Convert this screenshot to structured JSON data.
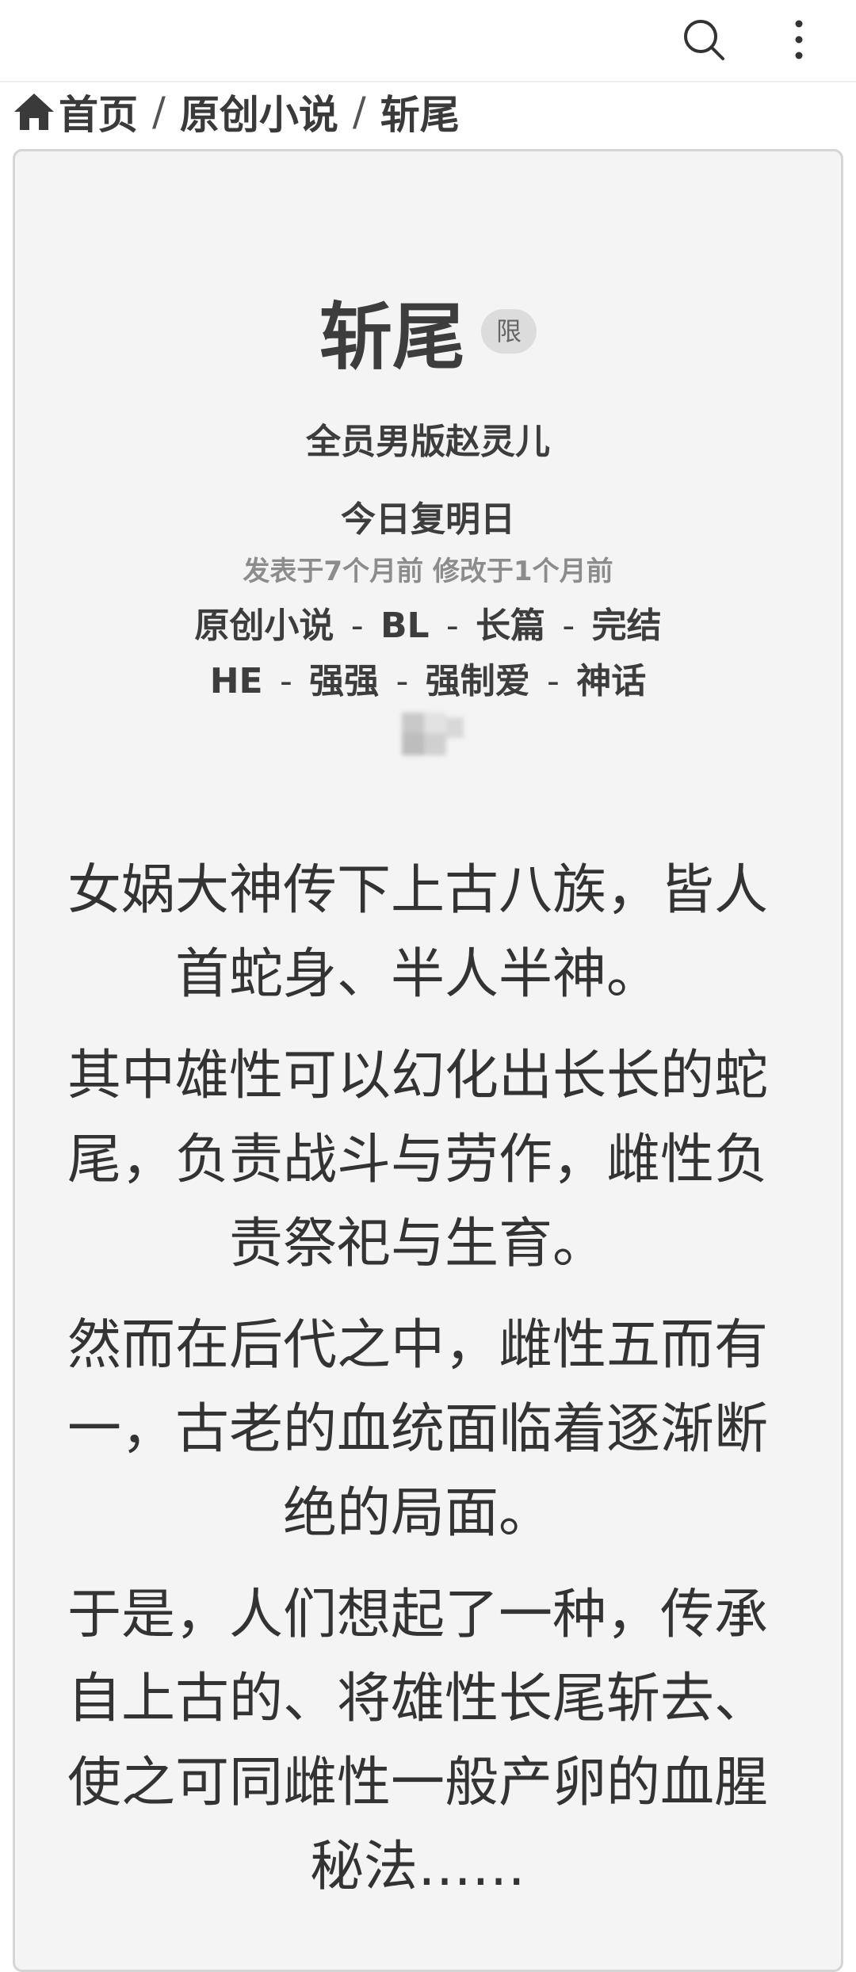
{
  "topbar": {
    "search_icon": "search-icon",
    "more_icon": "more-vertical-icon"
  },
  "breadcrumb": {
    "home_icon": "home-icon",
    "items": [
      "首页",
      "原创小说",
      "斩尾"
    ],
    "separator": "/"
  },
  "work": {
    "title": "斩尾",
    "badge": "限",
    "author": "全员男版赵灵儿",
    "subtitle": "今日复明日",
    "meta": "发表于7个月前 修改于1个月前",
    "tags_line1": [
      "原创小说",
      "BL",
      "长篇",
      "完结"
    ],
    "tags_line2": [
      "HE",
      "强强",
      "强制爱",
      "神话"
    ],
    "tag_separator": "-"
  },
  "summary": [
    "女娲大神传下上古八族，皆人首蛇身、半人半神。",
    "其中雄性可以幻化出长长的蛇尾，负责战斗与劳作，雌性负责祭祀与生育。",
    "然而在后代之中，雌性五而有一，古老的血统面临着逐渐断绝的局面。",
    "于是，人们想起了一种，传承自上古的、将雄性长尾斩去、使之可同雌性一般产卵的血腥秘法……"
  ],
  "colors": {
    "card_bg": "#f4f4f5",
    "card_border": "#d6d6d6",
    "text": "#333333",
    "meta": "#8c8c8c",
    "badge_bg": "#dcdcdc"
  }
}
